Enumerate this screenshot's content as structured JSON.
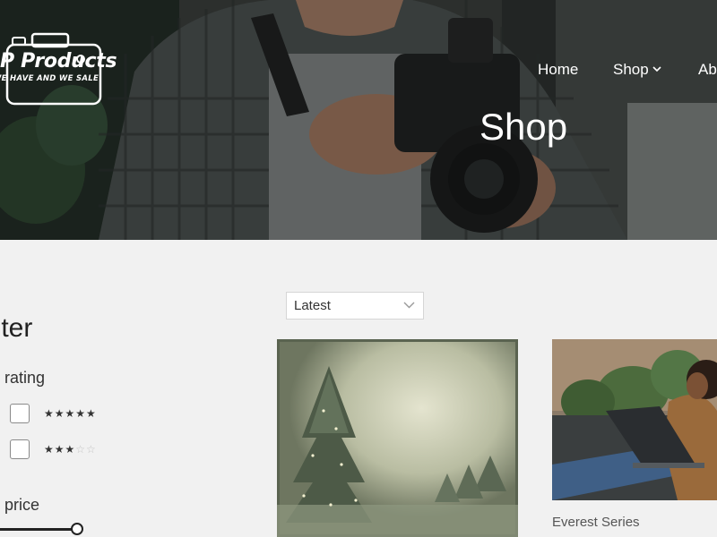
{
  "brand": {
    "name": "P Products",
    "tagline": "WE HAVE AND WE SALE"
  },
  "nav": {
    "home": "Home",
    "shop": "Shop",
    "about": "Ab"
  },
  "hero": {
    "title": "Shop"
  },
  "sort": {
    "selected": "Latest"
  },
  "filter": {
    "title": "ilter",
    "rating_title": "rating",
    "price_title": "price",
    "rating_options": [
      {
        "filled": 5,
        "total": 5,
        "stars_filled": "★★★★★",
        "stars_empty": ""
      },
      {
        "filled": 3,
        "total": 5,
        "stars_filled": "★★★",
        "stars_empty": "☆☆"
      }
    ],
    "price_slider_level": 1.0
  },
  "products": [
    {
      "image": "christmas-tree-backdrop",
      "name": ""
    },
    {
      "image": "woman-with-laptop",
      "name": "Everest Series"
    }
  ],
  "colors": {
    "page_bg": "#f1f1f1",
    "text_dark": "#222222",
    "hero_text": "#ffffff"
  }
}
